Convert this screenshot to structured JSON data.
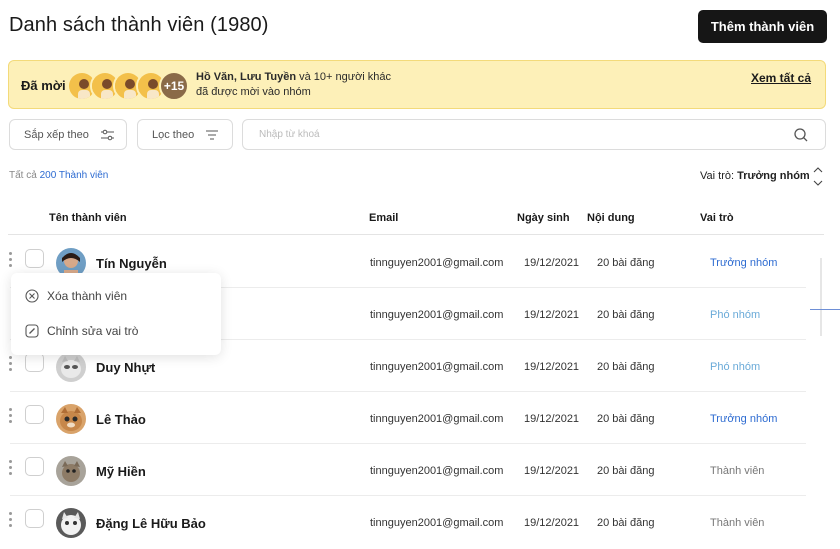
{
  "header": {
    "title": "Danh sách thành viên (1980)",
    "add_button": "Thêm thành viên"
  },
  "invited": {
    "label": "Đã mời",
    "more_count": "+15",
    "names": "Hồ Văn, Lưu Tuyền",
    "text_rest": " và 10+ người khác đã được mời vào nhóm",
    "see_all": "Xem tất cả"
  },
  "toolbar": {
    "sort_label": "Sắp xếp theo",
    "filter_label": "Lọc theo",
    "search_placeholder": "Nhập từ khoá"
  },
  "summary": {
    "all_label": "Tất cả",
    "count_link": "200 Thành viên",
    "role_sort_label": "Vai trò:",
    "role_sort_value": "Trưởng nhóm"
  },
  "table": {
    "columns": [
      "Tên thành viên",
      "Email",
      "Ngày sinh",
      "Nội dung",
      "Vai trò"
    ],
    "rows": [
      {
        "name": "Tín Nguyễn",
        "email": "tinnguyen2001@gmail.com",
        "dob": "19/12/2021",
        "content": "20 bài đăng",
        "role": "Trưởng nhóm",
        "role_type": "lead"
      },
      {
        "name": "",
        "email": "tinnguyen2001@gmail.com",
        "dob": "19/12/2021",
        "content": "20 bài đăng",
        "role": "Phó nhóm",
        "role_type": "deputy"
      },
      {
        "name": "Duy Nhựt",
        "email": "tinnguyen2001@gmail.com",
        "dob": "19/12/2021",
        "content": "20 bài đăng",
        "role": "Phó nhóm",
        "role_type": "deputy"
      },
      {
        "name": "Lê Thảo",
        "email": "tinnguyen2001@gmail.com",
        "dob": "19/12/2021",
        "content": "20 bài đăng",
        "role": "Trưởng nhóm",
        "role_type": "lead"
      },
      {
        "name": "Mỹ Hiền",
        "email": "tinnguyen2001@gmail.com",
        "dob": "19/12/2021",
        "content": "20 bài đăng",
        "role": "Thành viên",
        "role_type": "member"
      },
      {
        "name": "Đặng Lê Hữu Bảo",
        "email": "tinnguyen2001@gmail.com",
        "dob": "19/12/2021",
        "content": "20 bài đăng",
        "role": "Thành viên",
        "role_type": "member"
      }
    ]
  },
  "context_menu": {
    "remove_label": "Xóa thành viên",
    "edit_role_label": "Chỉnh sửa vai trò"
  },
  "colors": {
    "link": "#2d6bd1",
    "deputy": "#6aaad8",
    "banner_bg": "#fdf0b8",
    "button_bg": "#161616"
  }
}
